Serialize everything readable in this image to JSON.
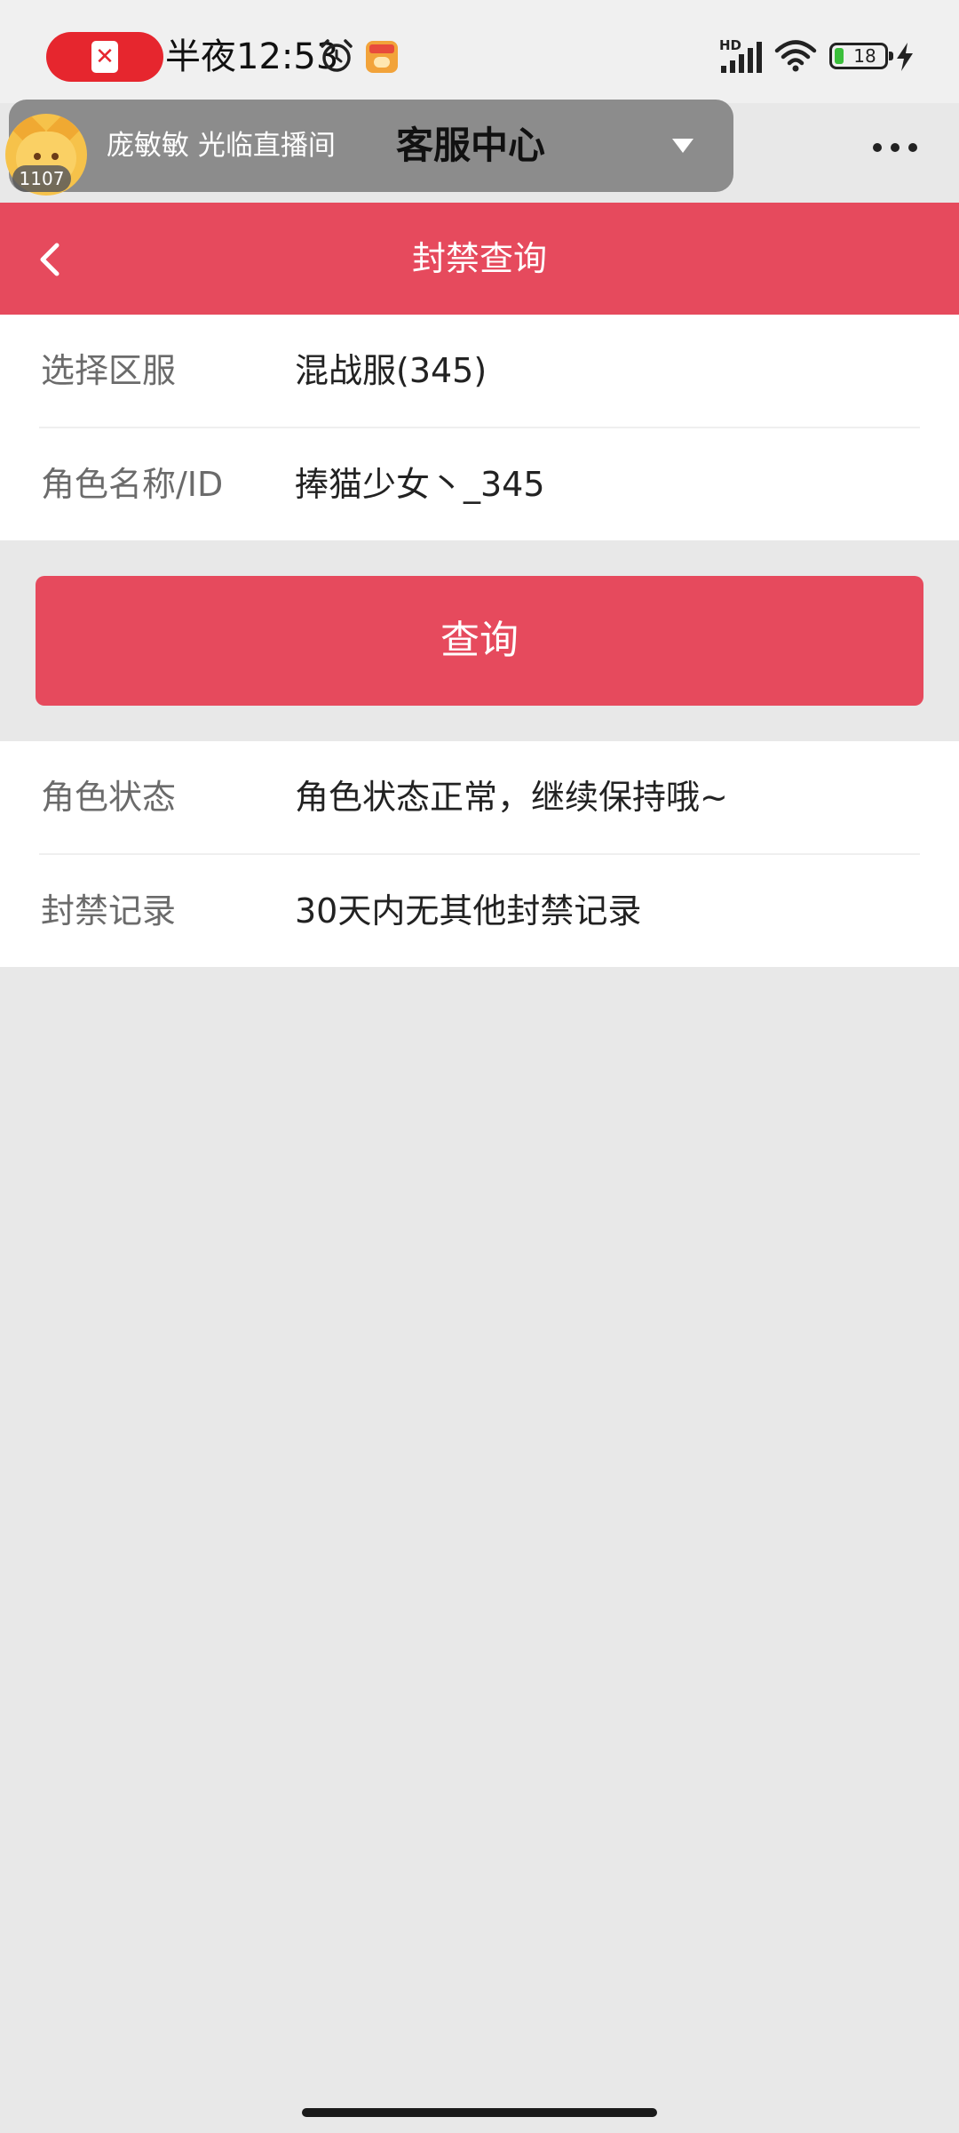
{
  "status_bar": {
    "time": "半夜12:53",
    "network_label": "HD",
    "battery_level": "18",
    "record_indicator_icon": "close-icon"
  },
  "live_overlay": {
    "viewer_count": "1107",
    "stream_title": "庞敏敏 光临直播间",
    "page_heading": "客服中心",
    "dropdown_icon": "triangle-down-icon",
    "more_icon": "more-dots-icon"
  },
  "header": {
    "title": "封禁查询",
    "back_icon": "chevron-left-icon",
    "color": "#e64a5d"
  },
  "form": {
    "server": {
      "label": "选择区服",
      "value": "混战服(345)"
    },
    "role": {
      "label": "角色名称/ID",
      "value": "捧猫少女丶_345"
    }
  },
  "query_button": {
    "label": "查询"
  },
  "result": {
    "status": {
      "label": "角色状态",
      "value": "角色状态正常，继续保持哦~"
    },
    "ban_record": {
      "label": "封禁记录",
      "value": "30天内无其他封禁记录"
    }
  }
}
